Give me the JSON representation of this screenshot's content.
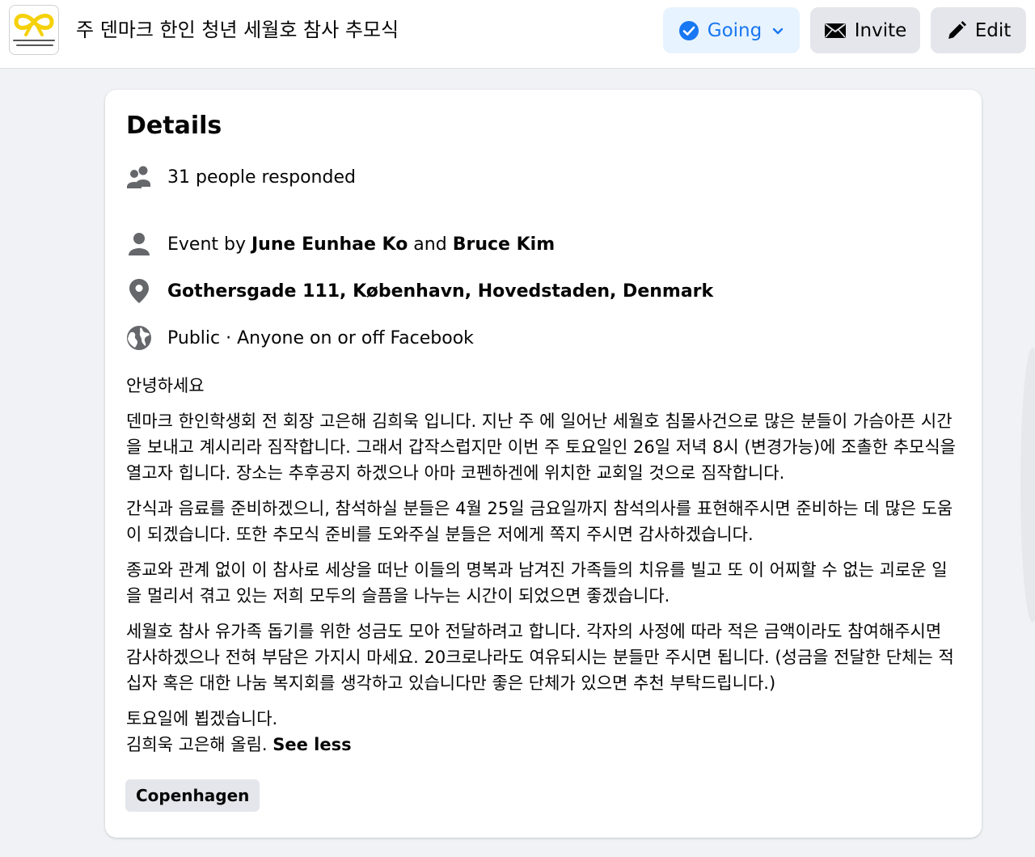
{
  "header": {
    "event_title": "주 덴마크 한인 청년 세월호 참사 추모식",
    "going_label": "Going",
    "invite_label": "Invite",
    "edit_label": "Edit"
  },
  "details": {
    "title": "Details",
    "responded": "31 people responded",
    "event_by_prefix": "Event by ",
    "host_1": "June Eunhae Ko",
    "host_joiner": " and ",
    "host_2": "Bruce Kim",
    "location": "Gothersgade 111, København, Hovedstaden, Denmark",
    "privacy": "Public · Anyone on or off Facebook",
    "paragraphs": [
      "안녕하세요",
      "덴마크 한인학생회 전 회장 고은해 김희욱 입니다. 지난 주 에 일어난 세월호 침몰사건으로 많은 분들이 가슴아픈 시간을 보내고 계시리라 짐작합니다. 그래서 갑작스럽지만 이번 주 토요일인 26일 저녁 8시 (변경가능)에 조촐한 추모식을 열고자 힙니다. 장소는 추후공지 하겠으나 아마 코펜하겐에 위치한 교회일 것으로 짐작합니다.",
      "간식과 음료를 준비하겠으니, 참석하실 분들은 4월 25일 금요일까지 참석의사를 표현해주시면 준비하는 데 많은 도움이 되겠습니다. 또한 추모식 준비를 도와주실 분들은 저에게 쪽지 주시면 감사하겠습니다.",
      "종교와 관계 없이 이 참사로 세상을 떠난 이들의 명복과 남겨진 가족들의 치유를 빌고 또 이 어찌할 수 없는 괴로운 일을 멀리서 겪고 있는 저희 모두의 슬픔을 나누는 시간이 되었으면 좋겠습니다.",
      "세월호 참사 유가족 돕기를 위한 성금도 모아 전달하려고 합니다. 각자의 사정에 따라 적은 금액이라도 참여해주시면 감사하겠으나 전혀 부담은 가지시 마세요. 20크로나라도 여유되시는 분들만 주시면 됩니다. (성금을 전달한 단체는 적십자 혹은 대한 나눔 복지회를 생각하고 있습니다만 좋은 단체가 있으면 추천 부탁드립니다.)"
    ],
    "closing_line_1": "토요일에 뵙겠습니다.",
    "closing_line_2": "김희욱 고은해 올림. ",
    "see_less": "See less",
    "tag": "Copenhagen"
  },
  "colors": {
    "accent": "#1877f2",
    "going_bg": "#e7f3ff",
    "button_bg": "#e4e6eb",
    "page_bg": "#f0f2f5"
  },
  "icons": {
    "thumb": "yellow-ribbon-image",
    "going": "check-circle-icon",
    "going_dropdown": "chevron-down-icon",
    "invite": "envelope-icon",
    "edit": "pencil-icon",
    "responded": "people-icon",
    "host": "person-icon",
    "location": "map-pin-icon",
    "privacy": "globe-icon"
  }
}
